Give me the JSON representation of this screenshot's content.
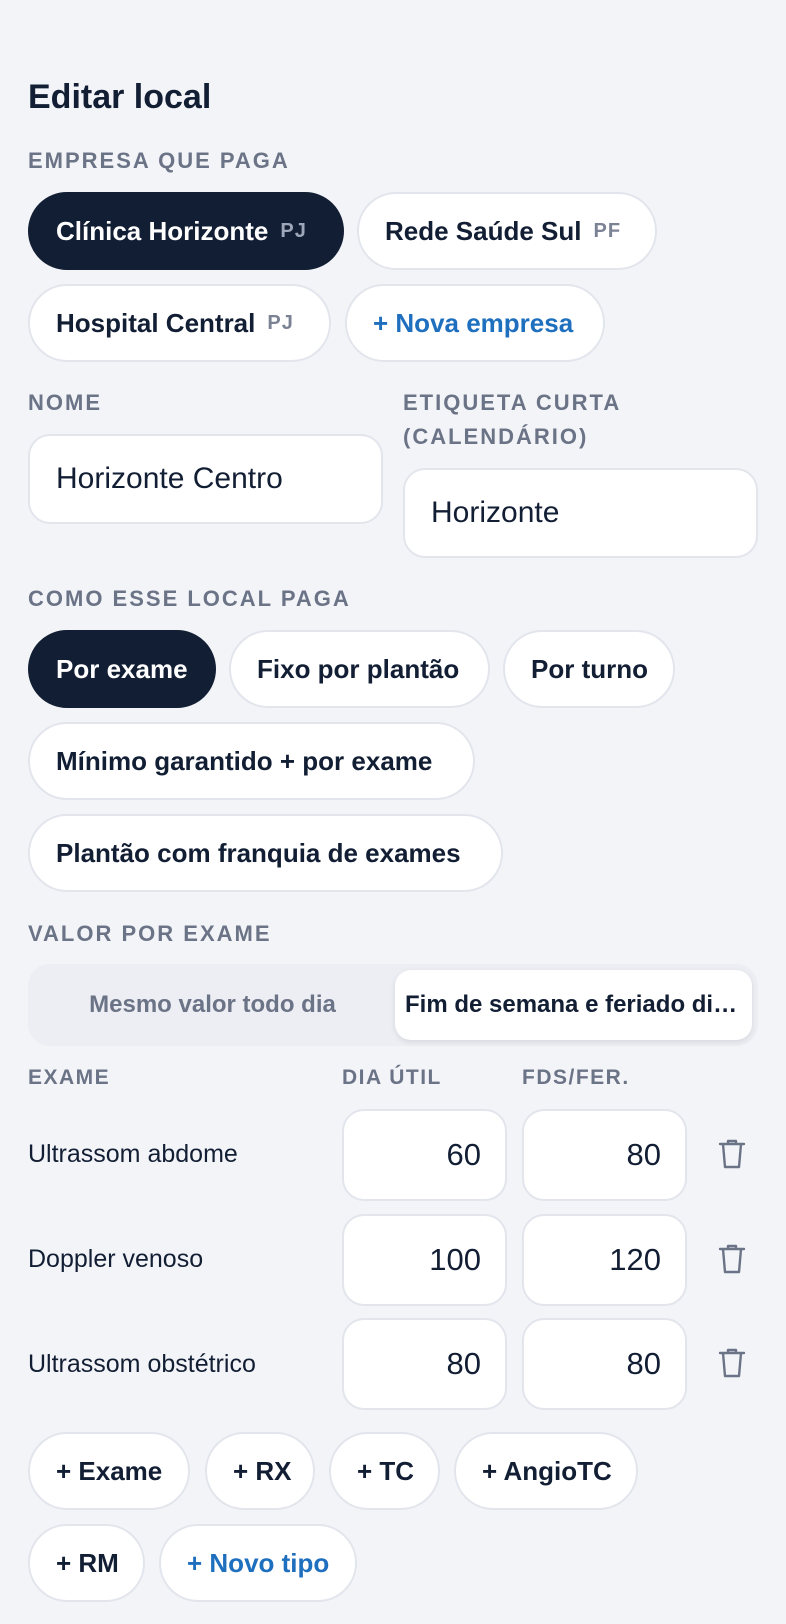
{
  "page": {
    "title": "Editar local"
  },
  "company": {
    "label": "EMPRESA QUE PAGA",
    "options": [
      {
        "name": "Clínica Horizonte",
        "tag": "PJ",
        "selected": true
      },
      {
        "name": "Rede Saúde Sul",
        "tag": "PF",
        "selected": false
      },
      {
        "name": "Hospital Central",
        "tag": "PJ",
        "selected": false
      }
    ],
    "new_label": "+ Nova empresa"
  },
  "name_field": {
    "label": "NOME",
    "value": "Horizonte Centro"
  },
  "short_label_field": {
    "label": "ETIQUETA CURTA (CALENDÁRIO)",
    "label_line1": "ETIQUETA CURTA",
    "label_line2": "(CALENDÁRIO)",
    "value": "Horizonte"
  },
  "payment": {
    "label": "COMO ESSE LOCAL PAGA",
    "options": [
      {
        "label": "Por exame",
        "selected": true
      },
      {
        "label": "Fixo por plantão",
        "selected": false
      },
      {
        "label": "Por turno",
        "selected": false
      },
      {
        "label": "Mínimo garantido + por exame",
        "selected": false
      },
      {
        "label": "Plantão com franquia de exames",
        "selected": false
      }
    ]
  },
  "exam_value": {
    "label": "VALOR POR EXAME",
    "modes": [
      {
        "label": "Mesmo valor todo dia",
        "selected": false
      },
      {
        "label": "Fim de semana e feriado diferente",
        "selected": true
      }
    ]
  },
  "table": {
    "headers": {
      "exam": "EXAME",
      "weekday": "DIA ÚTIL",
      "weekend": "FDS/FER."
    },
    "rows": [
      {
        "exam": "Ultrassom abdome",
        "weekday": "60",
        "weekend": "80"
      },
      {
        "exam": "Doppler venoso",
        "weekday": "100",
        "weekend": "120"
      },
      {
        "exam": "Ultrassom obstétrico",
        "weekday": "80",
        "weekend": "80"
      }
    ]
  },
  "add_types": {
    "options": [
      "+ Exame",
      "+ RX",
      "+ TC",
      "+ AngioTC",
      "+ RM"
    ],
    "new_label": "+ Novo tipo"
  },
  "colors": {
    "primary": "#121e33",
    "accent": "#1f6fbf",
    "muted": "#6b7386",
    "background": "#f3f4f8"
  },
  "icons": {
    "delete": "trash-icon"
  }
}
